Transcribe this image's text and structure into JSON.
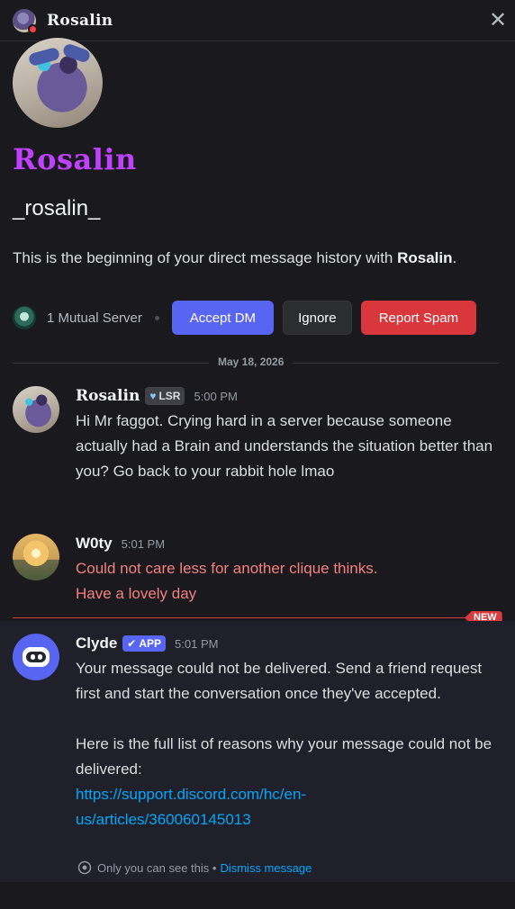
{
  "header": {
    "title": "Rosalin",
    "close_glyph": "✕"
  },
  "profile": {
    "display_name": "Rosalin",
    "username": "_rosalin_",
    "intro_text": "This is the beginning of your direct message history with ",
    "intro_name": "Rosalin",
    "intro_end": ".",
    "mutual_servers": "1 Mutual Server",
    "accept_label": "Accept DM",
    "ignore_label": "Ignore",
    "spam_label": "Report Spam"
  },
  "date_divider": "May 18, 2026",
  "messages": [
    {
      "author": "Rosalin",
      "tag": "LSR",
      "time": "5:00 PM",
      "text": "Hi Mr faggot. Crying hard in a server because someone actually had a Brain and understands the situation better than you? Go back to your rabbit hole lmao"
    },
    {
      "author": "W0ty",
      "time": "5:01 PM",
      "line1": "Could not care less for another clique thinks.",
      "line2": "Have a lovely day"
    },
    {
      "author": "Clyde",
      "tag": "APP",
      "time": "5:01 PM",
      "para1": "Your message could not be delivered. Send a friend request first and start the conversation once they've accepted.",
      "para2": "Here is the full list of reasons why your message could not be delivered:",
      "link_line1": "https://support.discord.com/hc/en-",
      "link_line2": "us/articles/360060145013"
    }
  ],
  "new_badge": "NEW",
  "ephemeral": {
    "text": "Only you can see this •",
    "dismiss": "Dismiss message"
  },
  "colors": {
    "accent": "#5865f2",
    "danger": "#da373c",
    "display_name": "#c040ff",
    "failed_text": "#f57f7f",
    "link": "#00a8fc"
  }
}
